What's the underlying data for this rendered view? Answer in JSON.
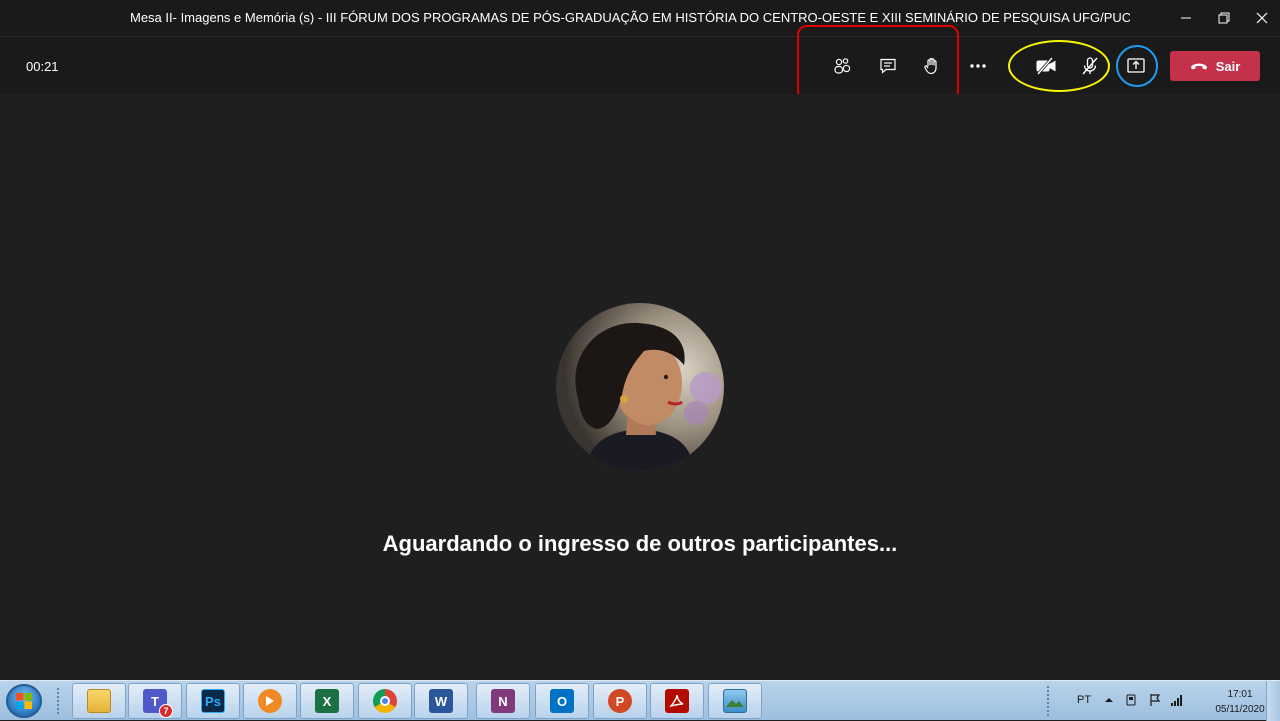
{
  "window": {
    "title": "Mesa II- Imagens e Memória (s) - III FÓRUM DOS PROGRAMAS DE PÓS-GRADUAÇÃO EM HISTÓRIA DO CENTRO-OESTE E XIII SEMINÁRIO DE PESQUISA UFG/PUC-GOIÁS",
    "controls": [
      "minimize-icon",
      "restore-icon",
      "close-icon"
    ]
  },
  "meeting": {
    "timer": "00:21",
    "controls": [
      "participants-icon",
      "chat-icon",
      "raise-hand-icon",
      "more-options-icon",
      "camera-off-icon",
      "mic-off-icon",
      "share-screen-icon"
    ],
    "leave_label": "Sair",
    "waiting_message": "Aguardando o ingresso de outros participantes...",
    "annotation_colors": {
      "red": "#e10000",
      "yellow": "#f6f600",
      "blue": "#1d9bf0"
    },
    "leave_color": "#c4314b"
  },
  "taskbar": {
    "apps": [
      {
        "name": "file-explorer-icon"
      },
      {
        "name": "teams-icon",
        "badge": "7"
      },
      {
        "name": "photoshop-icon",
        "label": "Ps"
      },
      {
        "name": "media-player-icon"
      },
      {
        "name": "excel-icon",
        "label": "X"
      },
      {
        "name": "chrome-icon"
      },
      {
        "name": "word-icon",
        "label": "W"
      },
      {
        "name": "onenote-icon",
        "label": "N"
      },
      {
        "name": "outlook-icon",
        "label": "O"
      },
      {
        "name": "powerpoint-icon",
        "label": "P"
      },
      {
        "name": "acrobat-icon"
      },
      {
        "name": "image-viewer-icon"
      }
    ],
    "tray": {
      "language": "PT",
      "time": "17:01",
      "date": "05/11/2020"
    }
  }
}
